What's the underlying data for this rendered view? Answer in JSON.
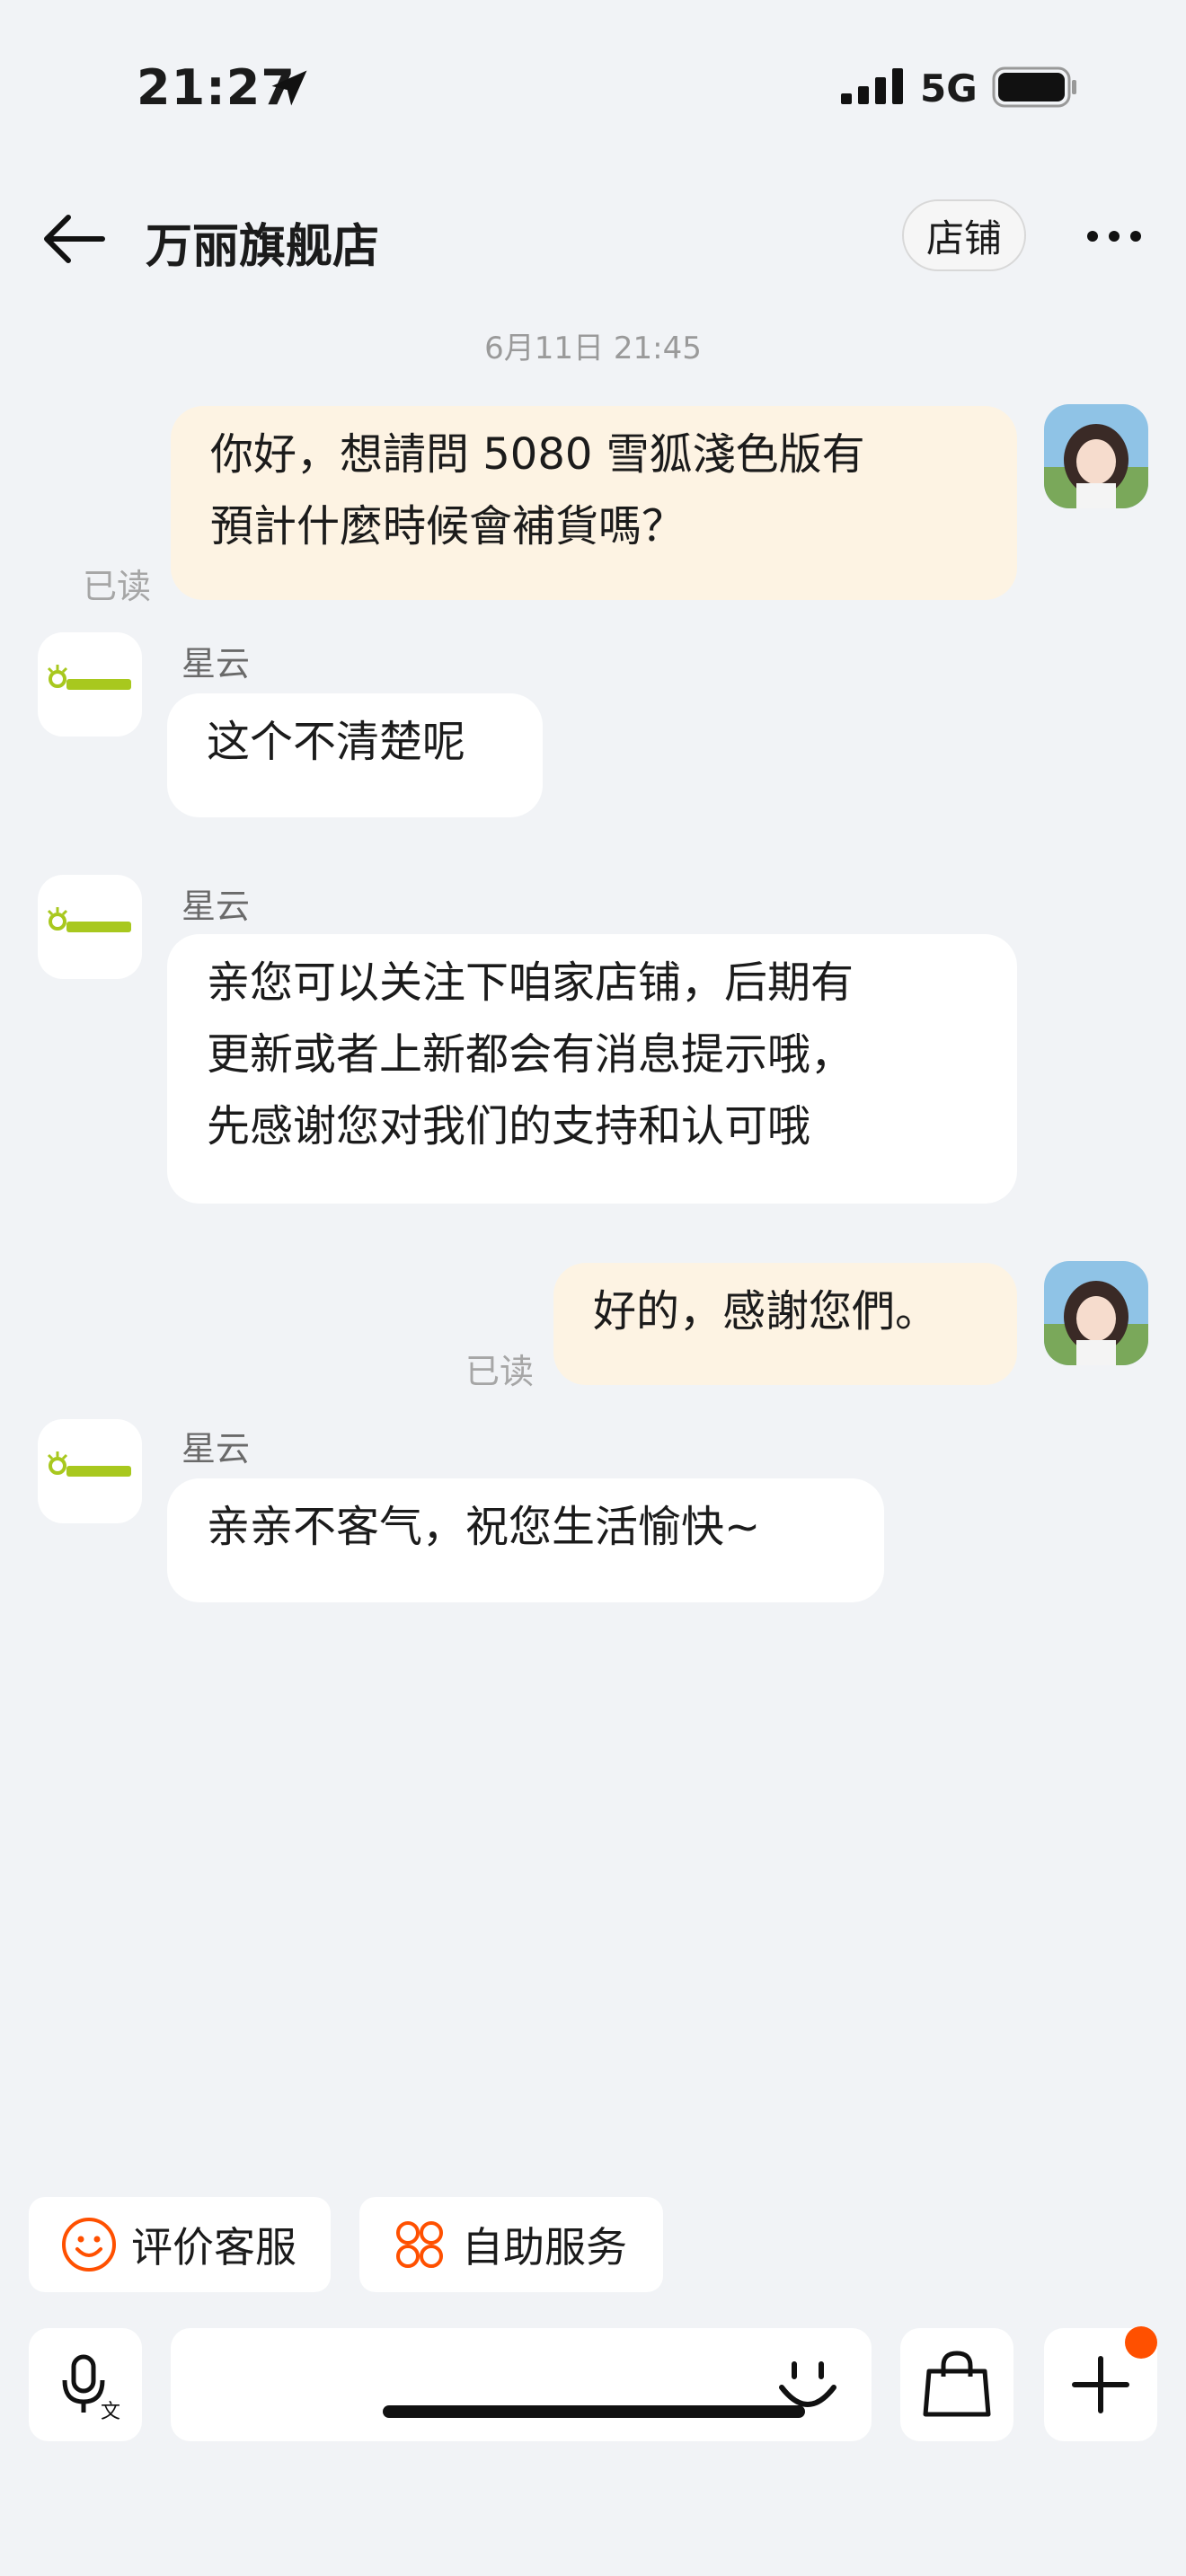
{
  "status_bar": {
    "time": "21:27",
    "network": "5G"
  },
  "header": {
    "title": "万丽旗舰店",
    "store_label": "店铺"
  },
  "timestamp": "6月11日 21:45",
  "messages": [
    {
      "from": "me",
      "lines": [
        "你好，想請問 5080 雪狐淺色版有",
        "預計什麼時候會補貨嗎？"
      ],
      "status": "已读"
    },
    {
      "from": "shop",
      "sender": "星云",
      "lines": [
        "这个不清楚呢"
      ]
    },
    {
      "from": "shop",
      "sender": "星云",
      "lines": [
        "亲您可以关注下咱家店铺，后期有",
        "更新或者上新都会有消息提示哦，",
        "先感谢您对我们的支持和认可哦"
      ]
    },
    {
      "from": "me",
      "lines": [
        "好的，感謝您們。"
      ],
      "status": "已读"
    },
    {
      "from": "shop",
      "sender": "星云",
      "lines": [
        "亲亲不客气，祝您生活愉快~"
      ]
    }
  ],
  "quick_actions": [
    {
      "label": "评价客服",
      "icon": "smile-icon"
    },
    {
      "label": "自助服务",
      "icon": "grid-service-icon"
    }
  ],
  "input_bar": {
    "placeholder": ""
  },
  "colors": {
    "background": "#f1f3f6",
    "my_bubble": "#fdf3e3",
    "shop_bubble": "#ffffff",
    "accent": "#ff5000",
    "brand_logo": "#a8c81e"
  }
}
